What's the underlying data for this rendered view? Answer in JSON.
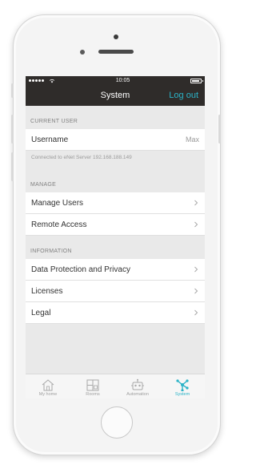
{
  "status_bar": {
    "time": "10:05"
  },
  "nav": {
    "title": "System",
    "logout_label": "Log out"
  },
  "sections": [
    {
      "header": "CURRENT USER"
    },
    {
      "header": "MANAGE"
    },
    {
      "header": "INFORMATION"
    }
  ],
  "current_user": {
    "username_label": "Username",
    "username_value": "Max",
    "connection_note": "Connected to eNet Server 192.168.188.149"
  },
  "manage": {
    "items": [
      {
        "label": "Manage Users"
      },
      {
        "label": "Remote Access"
      }
    ]
  },
  "information": {
    "items": [
      {
        "label": "Data Protection and Privacy"
      },
      {
        "label": "Licenses"
      },
      {
        "label": "Legal"
      }
    ]
  },
  "tabs": [
    {
      "label": "My home",
      "icon": "house-icon"
    },
    {
      "label": "Rooms",
      "icon": "rooms-icon"
    },
    {
      "label": "Automation",
      "icon": "robot-icon"
    },
    {
      "label": "System",
      "icon": "network-icon",
      "active": true
    }
  ],
  "colors": {
    "accent": "#2bb3c7",
    "header_bg": "#2f2c2a",
    "background": "#e9e9e9"
  }
}
